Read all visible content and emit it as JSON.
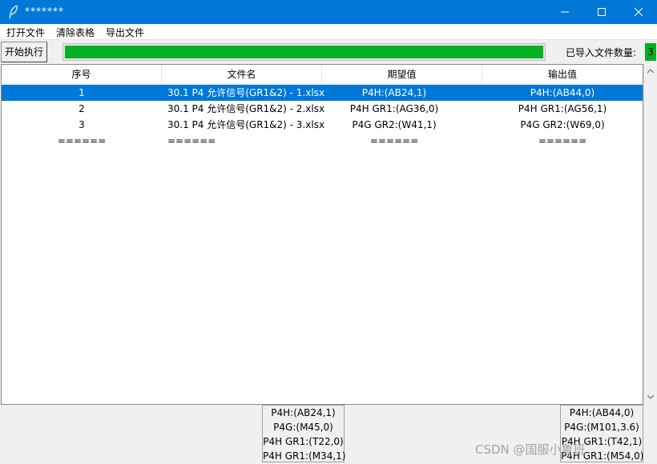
{
  "window": {
    "title": "*******"
  },
  "menu": [
    {
      "label": "打开文件"
    },
    {
      "label": "清除表格"
    },
    {
      "label": "导出文件"
    }
  ],
  "toolbar": {
    "start_label": "开始执行",
    "progress_fraction": 1.0,
    "count_label": "已导入文件数量:",
    "count_value": "3"
  },
  "table": {
    "columns": [
      "序号",
      "文件名",
      "期望值",
      "输出值"
    ],
    "rows": [
      {
        "idx": "1",
        "file": "30.1 P4 允许信号(GR1&2) - 1.xlsx",
        "expected": "P4H:(AB24,1)",
        "output": "P4H:(AB44,0)",
        "selected": true
      },
      {
        "idx": "2",
        "file": "30.1 P4 允许信号(GR1&2) - 2.xlsx",
        "expected": "P4H GR1:(AG36,0)",
        "output": "P4H GR1:(AG56,1)",
        "selected": false
      },
      {
        "idx": "3",
        "file": "30.1 P4 允许信号(GR1&2) - 3.xlsx",
        "expected": "P4G GR2:(W41,1)",
        "output": "P4G GR2:(W69,0)",
        "selected": false
      },
      {
        "idx": "======",
        "file": "======",
        "expected": "======",
        "output": "======",
        "selected": false
      }
    ]
  },
  "detail_expected": [
    "P4H:(AB24,1)",
    "P4G:(M45,0)",
    "P4H GR1:(T22,0)",
    "P4H GR1:(M34,1)"
  ],
  "detail_output": [
    "P4H:(AB44,0)",
    "P4G:(M101,3.6)",
    "P4H GR1:(T42,1)",
    "P4H GR1:(M54,0)"
  ],
  "watermark": "CSDN @国服小鲁班",
  "colors": {
    "titlebar": "#0078d7",
    "selection": "#0078d7",
    "progress": "#06b025"
  }
}
